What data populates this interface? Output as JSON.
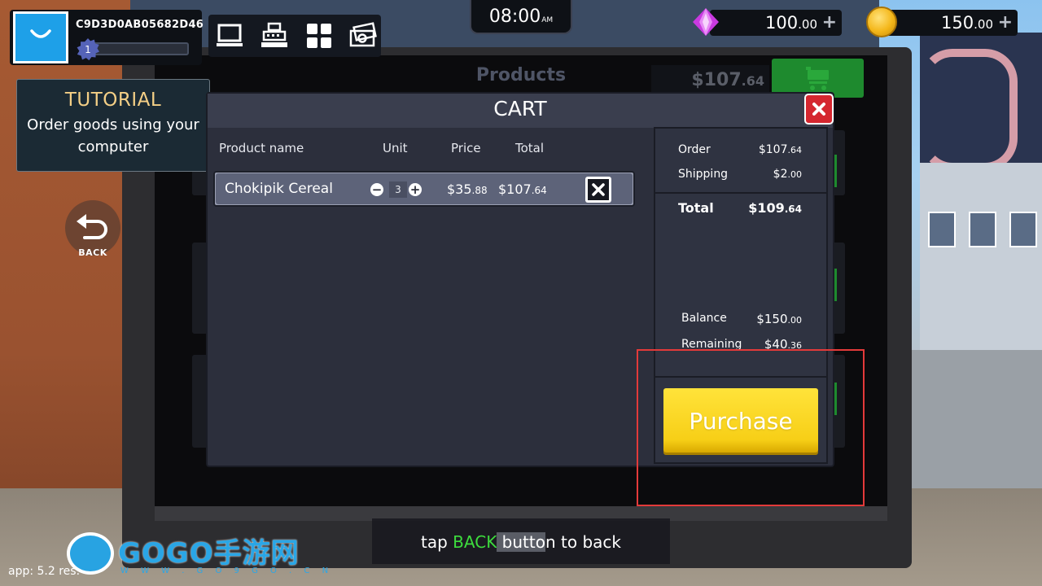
{
  "player": {
    "id": "C9D3D0AB05682D46",
    "level": "1",
    "xp_fraction": 0.05
  },
  "clock": {
    "time": "08:00",
    "ampm": "AM"
  },
  "currency": {
    "gems": "100",
    "gems_dec": ".00",
    "coins": "150",
    "coins_dec": ".00",
    "plus": "+"
  },
  "toolbar": {
    "icons": [
      "computer-icon",
      "cash-register-icon",
      "grid-apps-icon",
      "money-icon"
    ]
  },
  "tutorial": {
    "title": "TUTORIAL",
    "text": "Order goods using your computer"
  },
  "back": {
    "label": "BACK"
  },
  "background_screen": {
    "title": "Products",
    "price": "$107",
    "price_dec": ".64"
  },
  "cart": {
    "title": "CART",
    "columns": {
      "product_name": "Product name",
      "unit": "Unit",
      "price": "Price",
      "total": "Total"
    },
    "items": [
      {
        "name": "Chokipik Cereal",
        "quantity": "3",
        "price": "$35",
        "price_dec": ".88",
        "total": "$107",
        "total_dec": ".64"
      }
    ]
  },
  "summary": {
    "order_label": "Order",
    "order_value": "$107",
    "order_dec": ".64",
    "shipping_label": "Shipping",
    "shipping_value": "$2",
    "shipping_dec": ".00",
    "total_label": "Total",
    "total_value": "$109",
    "total_dec": ".64",
    "balance_label": "Balance",
    "balance_value": "$150",
    "balance_dec": ".00",
    "remaining_label": "Remaining",
    "remaining_value": "$40",
    "remaining_dec": ".36",
    "purchase_label": "Purchase"
  },
  "hint": {
    "prefix": "tap ",
    "keyword": "BACK",
    "highlight": " butto",
    "suffix": "n to back"
  },
  "watermark": {
    "brand": "GOGO手游网",
    "url": "W W W . G O 9 G O . C N"
  },
  "app_info": "app: 5.2 res."
}
